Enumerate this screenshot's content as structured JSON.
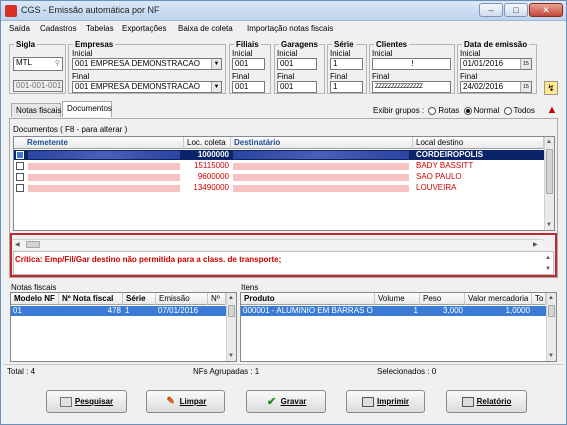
{
  "window": {
    "title": "CGS - Emissão automática por NF"
  },
  "menu": [
    "Saída",
    "Cadastros",
    "Tabelas",
    "Exportações",
    "Baixa de coleta",
    "Importação notas fiscais"
  ],
  "filters": {
    "sigla": {
      "label": "Sigla",
      "value": "MTL",
      "code": "001-001-001"
    },
    "empresas": {
      "label": "Empresas",
      "inicial_label": "Inicial",
      "final_label": "Final",
      "inicial": "001 EMPRESA DEMONSTRACAO",
      "final": "001 EMPRESA DEMONSTRACAO"
    },
    "filiais": {
      "label": "Filiais",
      "inicial_label": "Inicial",
      "final_label": "Final",
      "inicial": "001",
      "final": "001"
    },
    "garagens": {
      "label": "Garagens",
      "inicial_label": "Inicial",
      "final_label": "Final",
      "inicial": "001",
      "final": "001"
    },
    "serie": {
      "label": "Série",
      "inicial_label": "Inicial",
      "final_label": "Final",
      "inicial": "1",
      "final": "1"
    },
    "clientes": {
      "label": "Clientes",
      "inicial_label": "Inicial",
      "final_label": "Final",
      "inicial": "!",
      "final": "ZZZZZZZZZZZZZZZ"
    },
    "data_emissao": {
      "label": "Data de emissão",
      "inicial_label": "Inicial",
      "final_label": "Final",
      "inicial": "01/01/2016",
      "final": "24/02/2016"
    }
  },
  "tabs": [
    "Notas fiscais",
    "Documentos"
  ],
  "exibir_grupos": {
    "label": "Exibir grupos :",
    "options": [
      "Rotas",
      "Normal",
      "Todos"
    ],
    "selected": "Normal"
  },
  "documentos": {
    "title": "Documentos ( F8 - para alterar )",
    "columns": [
      "Remetente",
      "Loc. coleta",
      "Destinatário",
      "Local destino"
    ],
    "rows": [
      {
        "loc": "1000000",
        "destino": "CORDEIROPOLIS",
        "selected": true
      },
      {
        "loc": "15115000",
        "destino": "BADY BASSITT",
        "selected": false
      },
      {
        "loc": "9600000",
        "destino": "SAO PAULO",
        "selected": false
      },
      {
        "loc": "13490000",
        "destino": "LOUVEIRA",
        "selected": false
      }
    ]
  },
  "critica": "Crítica: Emp/Fil/Gar destino não permitida para a class. de transporte;",
  "notas": {
    "label": "Notas fiscais",
    "columns": [
      "Modelo NF",
      "Nº Nota fiscal",
      "Série",
      "Emissão",
      "Nº"
    ],
    "rows": [
      {
        "modelo": "01",
        "numero": "478",
        "serie": "1",
        "emissao": "07/01/2016"
      }
    ]
  },
  "itens": {
    "label": "Itens",
    "columns": [
      "Produto",
      "Volume",
      "Peso",
      "Valor mercadoria",
      "To"
    ],
    "rows": [
      {
        "produto": "000001 - ALUMINIO EM BARRAS OU",
        "volume": "1",
        "peso": "3,000",
        "valor": "1,0000"
      }
    ]
  },
  "status": {
    "total": "Total : 4",
    "agrupadas": "NFs Agrupadas : 1",
    "selecionados": "Selecionados : 0"
  },
  "buttons": {
    "pesquisar": "Pesquisar",
    "limpar": "Limpar",
    "gravar": "Gravar",
    "imprimir": "Imprimir",
    "relatorio": "Relatório"
  },
  "colors": {
    "selection": "#0a246a",
    "critical": "#cc0000",
    "border_highlight": "#c0282d",
    "row_text_red": "#d00000"
  }
}
